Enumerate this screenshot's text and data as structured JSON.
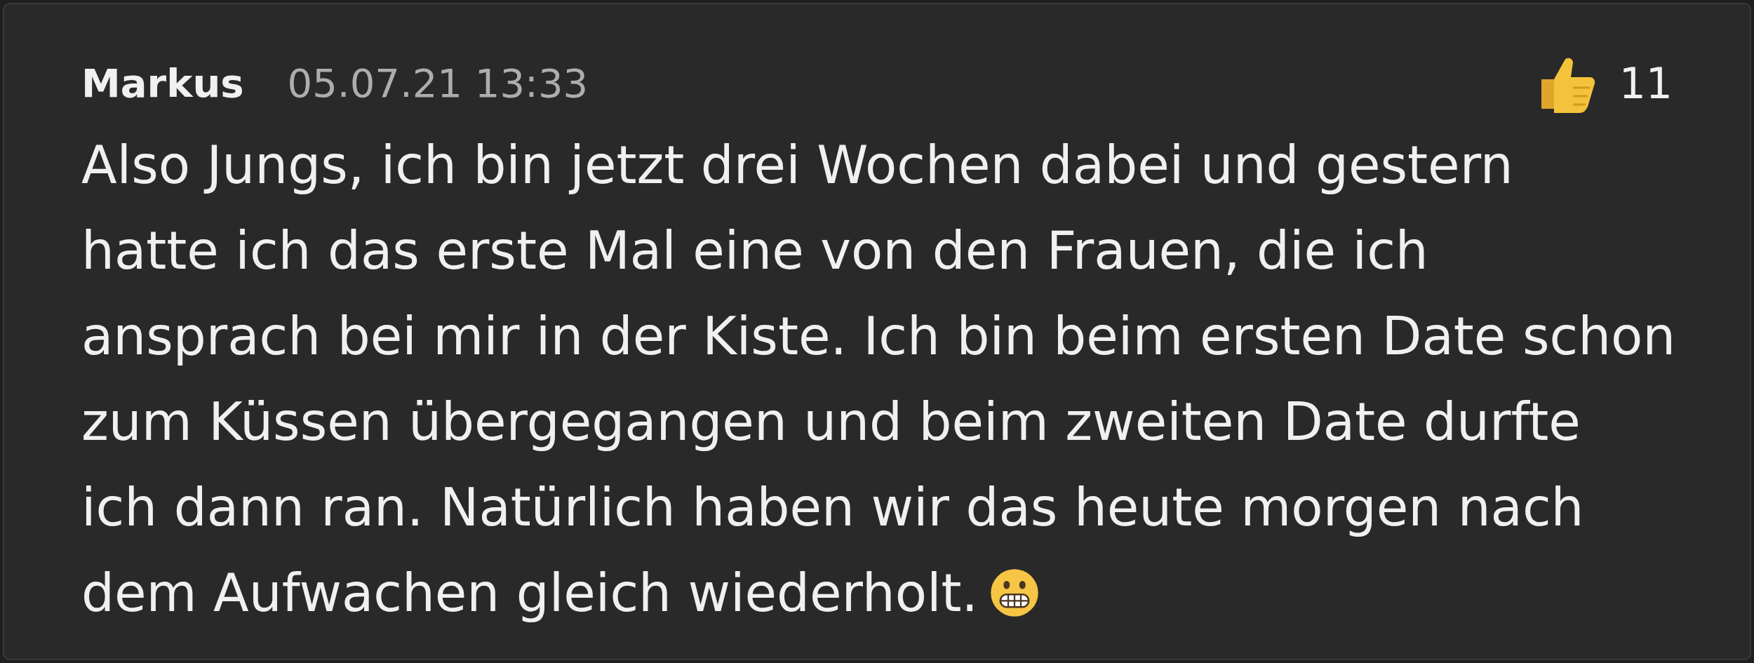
{
  "message": {
    "author": "Markus",
    "timestamp": "05.07.21 13:33",
    "reaction": {
      "count": "11"
    },
    "lines": [
      "Also Jungs, ich bin jetzt drei Wochen dabei und gestern",
      "hatte ich das erste Mal eine von den Frauen, die ich",
      "ansprach bei mir in der Kiste. Ich bin beim ersten Date schon",
      "zum Küssen übergegangen und beim zweiten Date durfte",
      "ich dann ran. Natürlich haben wir das heute morgen nach",
      "dem Aufwachen gleich wiederholt."
    ]
  }
}
